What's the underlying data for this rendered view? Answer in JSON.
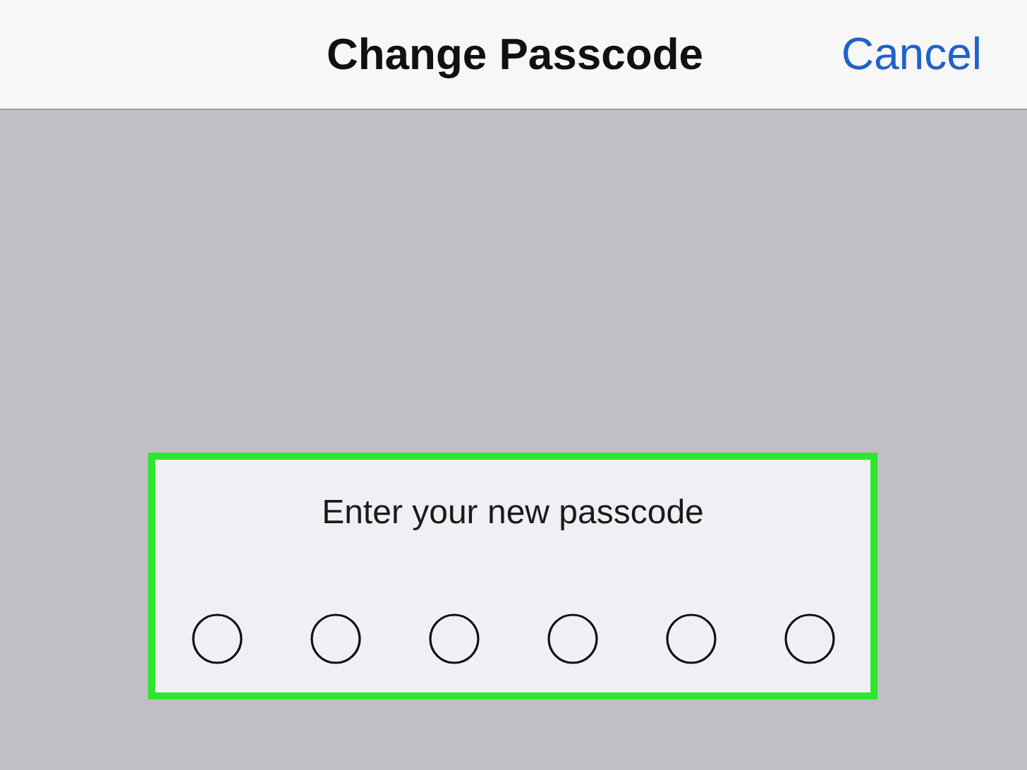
{
  "nav_bar": {
    "title": "Change Passcode",
    "cancel_button": "Cancel"
  },
  "passcode_panel": {
    "prompt": "Enter your new passcode",
    "highlighted": true,
    "digits": [
      {
        "filled": false
      },
      {
        "filled": false
      },
      {
        "filled": false
      },
      {
        "filled": false
      },
      {
        "filled": false
      },
      {
        "filled": false
      }
    ]
  }
}
